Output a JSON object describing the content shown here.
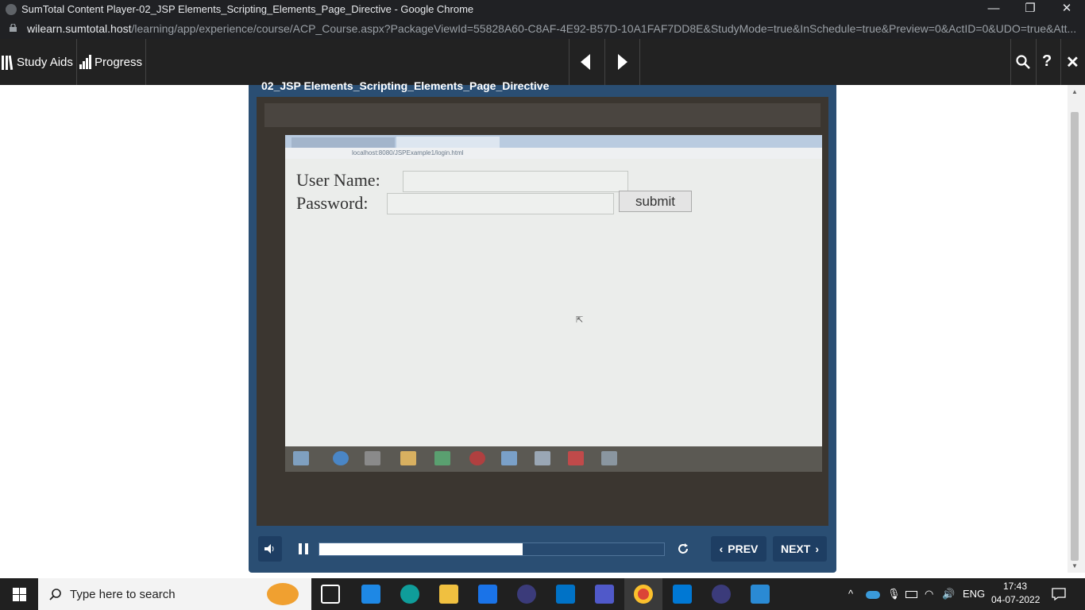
{
  "window": {
    "title": "SumTotal Content Player-02_JSP Elements_Scripting_Elements_Page_Directive - Google Chrome"
  },
  "address_bar": {
    "host": "wilearn.sumtotal.host",
    "path": "/learning/app/experience/course/ACP_Course.aspx?PackageViewId=55828A60-C8AF-4E92-B57D-10A1FAF7DD8E&StudyMode=true&InSchedule=true&Preview=0&ActID=0&UDO=true&Att..."
  },
  "toolbar": {
    "study_aids": "Study Aids",
    "progress": "Progress"
  },
  "player": {
    "title": "02_JSP Elements_Scripting_Elements_Page_Directive",
    "playback_progress": 0.59,
    "video": {
      "url": "localhost:8080/JSPExample1/login.html",
      "user_label": "User Name:",
      "password_label": "Password:",
      "submit_label": "submit"
    },
    "prev_label": "PREV",
    "next_label": "NEXT"
  },
  "taskbar": {
    "search_placeholder": "Type here to search",
    "language": "ENG",
    "time": "17:43",
    "date": "04-07-2022"
  },
  "icons": [
    "windows-icon",
    "search-icon",
    "task-view-icon",
    "store-icon",
    "edge-icon",
    "file-explorer-icon",
    "mail-icon",
    "eclipse-icon",
    "outlook-icon",
    "teams-icon",
    "chrome-icon",
    "vscode-icon",
    "eclipse-icon",
    "photos-icon"
  ]
}
